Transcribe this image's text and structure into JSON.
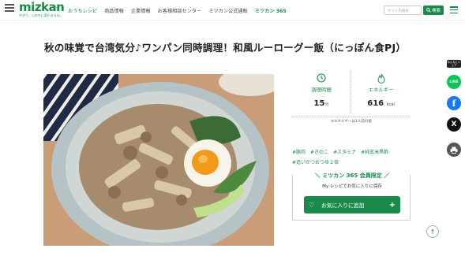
{
  "header": {
    "logo_main": "mizkan",
    "logo_sub": "やがて、いのちに変わるもの。",
    "nav": [
      {
        "label": "おうちレシピ",
        "active": true
      },
      {
        "label": "商品情報",
        "active": false
      },
      {
        "label": "企業情報",
        "active": false
      },
      {
        "label": "お客様相談センター",
        "active": false
      },
      {
        "label": "ミツカン公式通販",
        "active": false
      }
    ],
    "brand_link": "ミツカン 365",
    "search_placeholder": "サイト内検索",
    "search_button": "検索"
  },
  "recipe": {
    "title": "秋の味覚で台湾気分♪ワンパン同時調理！和風ルーローグー飯（にっぽん食PJ）"
  },
  "info": {
    "time_label": "調理時間",
    "time_value": "15",
    "time_unit": "分",
    "energy_label": "エネルギー",
    "energy_value": "616",
    "energy_unit": "kcal",
    "note": "※エネルギーは1人前の値"
  },
  "tags": [
    "#豚肉",
    "#きのこ",
    "#スタミナ",
    "#純玄米黒酢",
    "#追いがつおつゆ２倍"
  ],
  "member": {
    "title": "ミツカン 365 会員限定",
    "subtitle": "My レシピでお気に入りに保存",
    "fav_button": "お気に入りに追加"
  },
  "share": {
    "label": "みんなにシェア",
    "line": "LINE",
    "fb": "f",
    "x": "X"
  },
  "colors": {
    "brand_green": "#1a8a4a",
    "line_green": "#06c755",
    "facebook_blue": "#1877f2"
  }
}
